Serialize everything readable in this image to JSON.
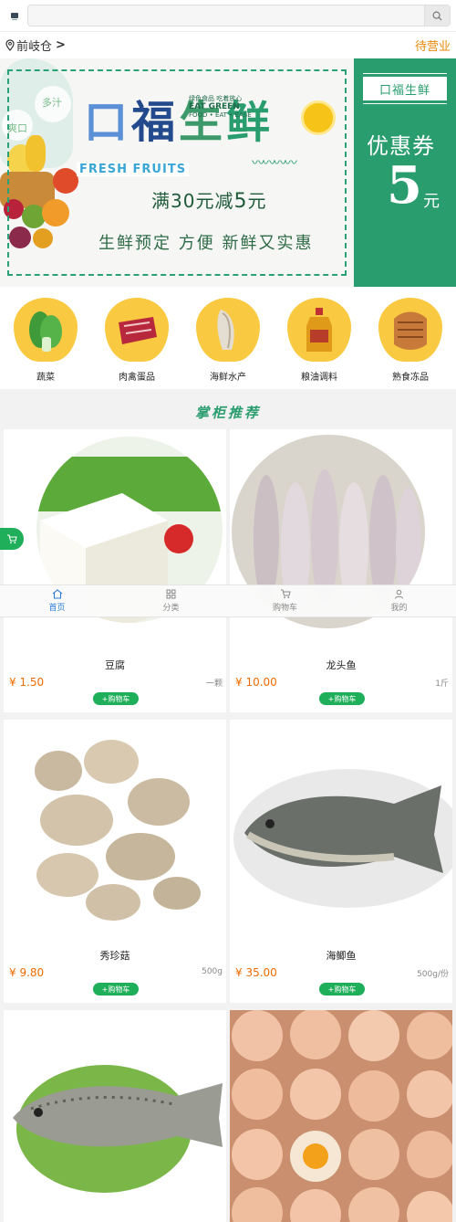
{
  "header": {
    "search_placeholder": ""
  },
  "location": {
    "name": "前岐仓",
    "status": "待营业"
  },
  "banner": {
    "title_chars": [
      "口",
      "福",
      "生",
      "鲜"
    ],
    "fresh_fruits": "FRESH FRUITS",
    "eat_green_line1": "绿色食品 吃着放心",
    "eat_green_line2": "EAT GREEN",
    "eat_green_line3": "FOOD • EAT • EASE",
    "bubble_1": "多汁",
    "bubble_2": "爽口",
    "promo_prefix": "满",
    "promo_amount": "30",
    "promo_mid": "元减",
    "promo_off": "5",
    "promo_suffix": "元",
    "slogan": "生鲜预定  方便 新鲜又实惠",
    "side_tag": "口福生鲜",
    "coupon_label": "优惠券",
    "coupon_value": "5",
    "coupon_unit": "元"
  },
  "categories": [
    {
      "label": "蔬菜",
      "icon": "vegetable-icon"
    },
    {
      "label": "肉禽蛋品",
      "icon": "meat-icon"
    },
    {
      "label": "海鲜水产",
      "icon": "seafood-icon"
    },
    {
      "label": "粮油调料",
      "icon": "oil-icon"
    },
    {
      "label": "熟食冻品",
      "icon": "cooked-food-icon"
    }
  ],
  "section": {
    "title": "掌柜推荐"
  },
  "products": [
    {
      "name": "豆腐",
      "price": "¥ 1.50",
      "unit": "一颗",
      "cart_label": "+购物车"
    },
    {
      "name": "龙头鱼",
      "price": "¥ 10.00",
      "unit": "1斤",
      "cart_label": "+购物车"
    },
    {
      "name": "秀珍菇",
      "price": "¥ 9.80",
      "unit": "500g",
      "cart_label": "+购物车"
    },
    {
      "name": "海鲫鱼",
      "price": "¥ 35.00",
      "unit": "500g/份",
      "cart_label": "+购物车"
    },
    {
      "name": "",
      "price": "",
      "unit": "",
      "cart_label": ""
    },
    {
      "name": "",
      "price": "",
      "unit": "",
      "cart_label": ""
    }
  ],
  "tabbar": [
    {
      "label": "首页",
      "icon": "home-icon",
      "active": true
    },
    {
      "label": "分类",
      "icon": "grid-icon",
      "active": false
    },
    {
      "label": "购物车",
      "icon": "cart-icon",
      "active": false
    },
    {
      "label": "我的",
      "icon": "user-icon",
      "active": false
    }
  ],
  "colors": {
    "brand_green": "#2a9d6f",
    "cart_green": "#1fae5a",
    "price_orange": "#ef6c00",
    "status_orange": "#e8890c",
    "tab_active_blue": "#2a7cd9"
  }
}
